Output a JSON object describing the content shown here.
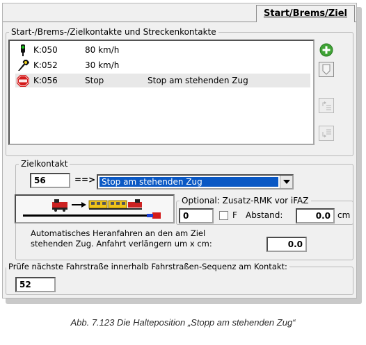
{
  "tab": {
    "label": "Start/Brems/Ziel"
  },
  "contacts": {
    "legend": "Start-/Brems-/Zielkontakte und Streckenkontakte",
    "rows": [
      {
        "icon": "green-signal-icon",
        "contact": "K:050",
        "speed": "80 km/h",
        "note": ""
      },
      {
        "icon": "yellow-signal-icon",
        "contact": "K:052",
        "speed": "30 km/h",
        "note": ""
      },
      {
        "icon": "stop-sign-icon",
        "contact": "K:056",
        "speed": "Stop",
        "note": "Stop am stehenden Zug"
      }
    ]
  },
  "target": {
    "legend": "Zielkontakt",
    "contact_value": "56",
    "arrow_text": "==>",
    "mode_selected": "Stop am stehenden Zug",
    "optional_legend": "Optional: Zusatz-RMK vor iFAZ",
    "optional_value": "0",
    "f_label": "F",
    "distance_label": "Abstand:",
    "distance_value": "0.0",
    "distance_unit": "cm",
    "auto_text_line1": "Automatisches Heranfahren an den am Ziel",
    "auto_text_line2": "stehenden Zug. Anfahrt verlängern um x cm:",
    "auto_value": "0.0"
  },
  "route": {
    "legend": "Prüfe nächste Fahrstraße innerhalb Fahrstraßen-Sequenz am Kontakt:",
    "value": "52"
  },
  "caption": "Abb. 7.123  Die Halteposition „Stopp am stehenden Zug“",
  "colors": {
    "selection": "#0a58c4",
    "add_button": "#3fa335",
    "stop_red": "#d31a1a"
  }
}
